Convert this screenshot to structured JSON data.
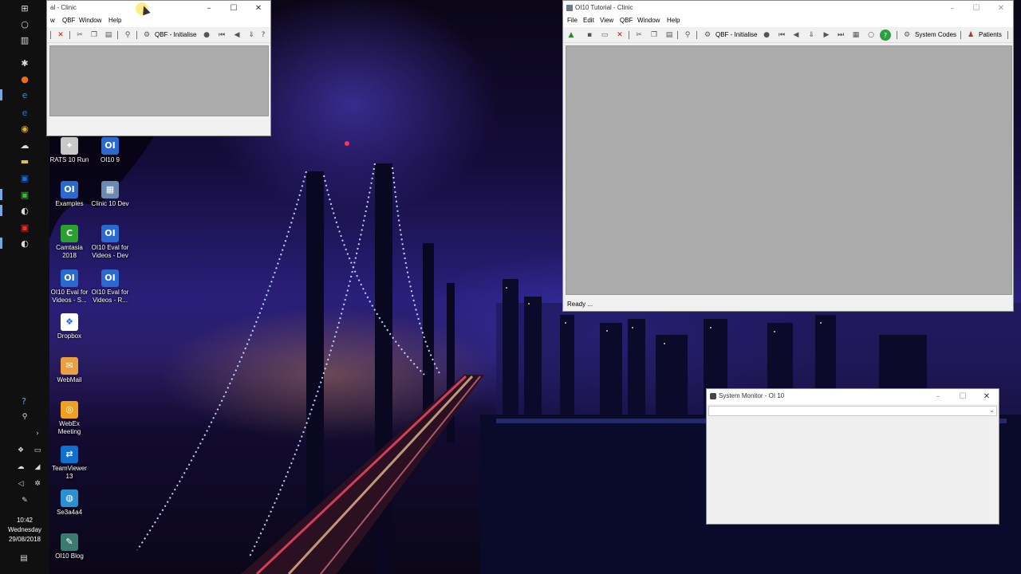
{
  "colors": {
    "accent": "#0078d7",
    "error_x": "#d01010",
    "client_gray": "#ababab"
  },
  "taskbar": {
    "icons": [
      "windows-logo-icon",
      "cortana-circle-icon",
      "task-view-icon",
      "app-icon",
      "firefox-icon",
      "edge-icon",
      "ie-icon",
      "chrome-icon",
      "cloud-app-icon",
      "file-explorer-icon",
      "outlook-icon",
      "camtasia-icon",
      "oi-app-icon",
      "red-app-icon",
      "oi-app-icon-2"
    ],
    "clock": {
      "time": "10:42",
      "day": "Wednesday",
      "date": "29/08/2018"
    }
  },
  "desktop_icons": [
    {
      "label": "RATS 10 Run",
      "icon": "rats-run-icon",
      "color": "#c8c8c8",
      "glyph": "✦"
    },
    {
      "label": "OI10 9",
      "icon": "oi10-icon",
      "color": "#2a6ad0",
      "glyph": "OI"
    },
    {
      "label": "Examples",
      "icon": "examples-icon",
      "color": "#2a6ad0",
      "glyph": "OI"
    },
    {
      "label": "Clinic 10 Dev",
      "icon": "clinic-dev-icon",
      "color": "#6a8ab0",
      "glyph": "▦"
    },
    {
      "label": "Camtasia 2018",
      "icon": "camtasia-icon",
      "color": "#2aa030",
      "glyph": "C"
    },
    {
      "label": "OI10 Eval for Videos - Dev",
      "icon": "oi10-eval-dev-icon",
      "color": "#2a6ad0",
      "glyph": "OI"
    },
    {
      "label": "OI10 Eval for Videos - S...",
      "icon": "oi10-eval-s-icon",
      "color": "#2a6ad0",
      "glyph": "OI"
    },
    {
      "label": "OI10 Eval for Videos - R...",
      "icon": "oi10-eval-r-icon",
      "color": "#2a6ad0",
      "glyph": "OI"
    },
    {
      "label": "Dropbox",
      "icon": "dropbox-icon",
      "color": "#ffffff",
      "glyph": "❖"
    },
    {
      "label": "WebMail",
      "icon": "webmail-icon",
      "color": "#e8a040",
      "glyph": "✉"
    },
    {
      "label": "WebEx Meeting",
      "icon": "webex-icon",
      "color": "#f0a020",
      "glyph": "◎"
    },
    {
      "label": "TeamViewer 13",
      "icon": "teamviewer-icon",
      "color": "#1070d0",
      "glyph": "⇄"
    },
    {
      "label": "Se3a4a4",
      "icon": "globe-icon",
      "color": "#2a90d0",
      "glyph": "◍"
    },
    {
      "label": "OI10 Blog",
      "icon": "oi10-blog-icon",
      "color": "#3a7a70",
      "glyph": "✎"
    }
  ],
  "window_left": {
    "title": "al - Clinic",
    "menu": [
      "w",
      "QBF",
      "Window",
      "Help"
    ],
    "toolbar_label": "QBF - Initialise"
  },
  "window_right": {
    "title": "OI10 Tutorial - Clinic",
    "menu": [
      "File",
      "Edit",
      "View",
      "QBF",
      "Window",
      "Help"
    ],
    "toolbar_label": "QBF - Initialise",
    "system_codes": "System Codes",
    "patients": "Patients",
    "status": "Ready ..."
  },
  "window_monitor": {
    "title": "System Monitor - OI 10"
  }
}
